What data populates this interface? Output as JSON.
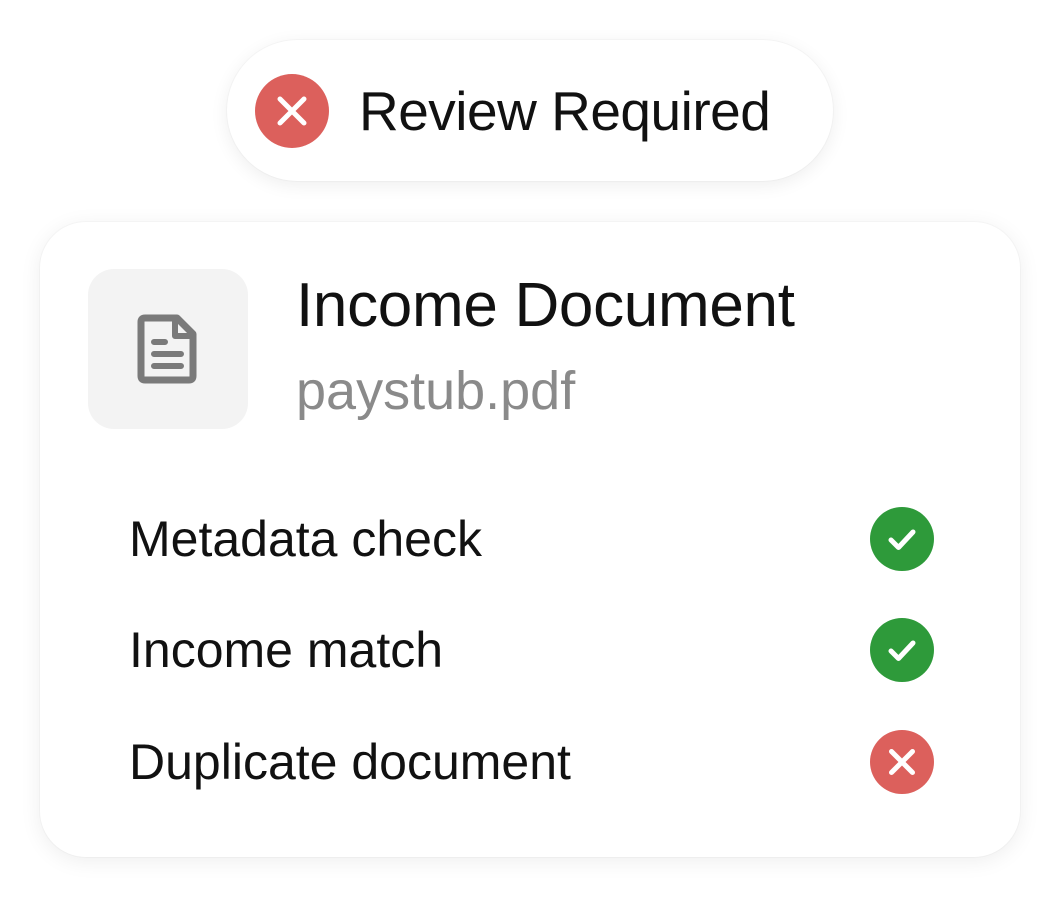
{
  "status": {
    "label": "Review Required",
    "icon": "close-circle-icon",
    "color": "#dc605c"
  },
  "document": {
    "icon": "document-icon",
    "title": "Income Document",
    "filename": "paystub.pdf"
  },
  "checks": [
    {
      "label": "Metadata check",
      "result": "pass",
      "icon": "check-circle-icon"
    },
    {
      "label": "Income match",
      "result": "pass",
      "icon": "check-circle-icon"
    },
    {
      "label": "Duplicate document",
      "result": "fail",
      "icon": "close-circle-icon"
    }
  ],
  "colors": {
    "pass": "#2e9a3a",
    "fail": "#dc605c",
    "tile_background": "#f3f3f3",
    "secondary_text": "#8a8a8a"
  }
}
